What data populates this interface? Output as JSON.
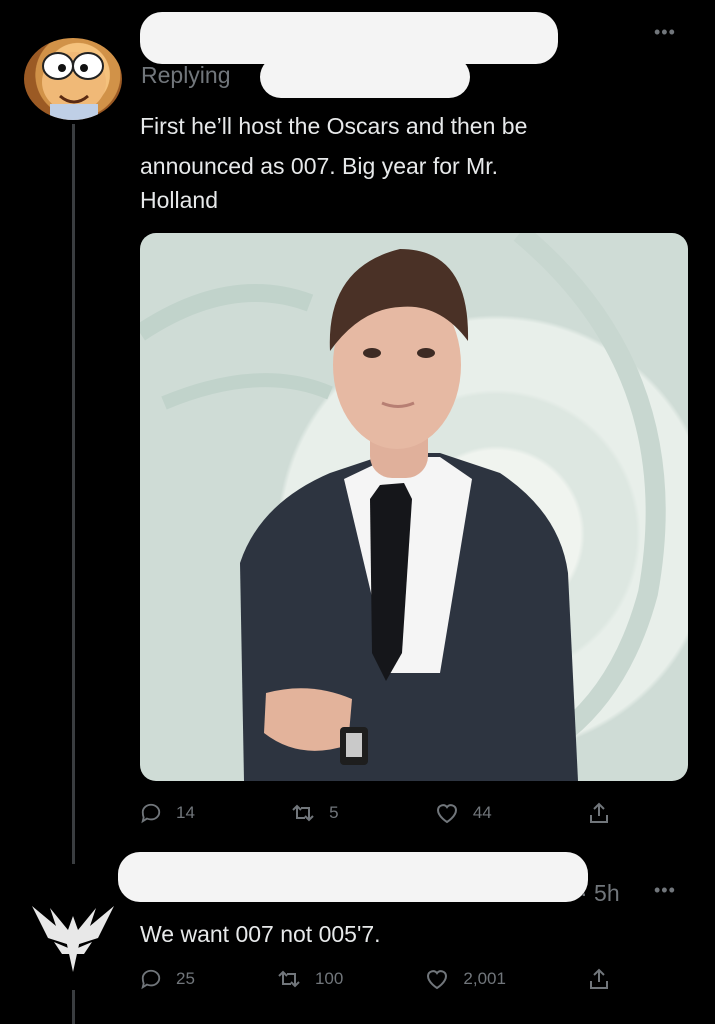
{
  "tweet1": {
    "replying_label": "Replying",
    "text_line1": "First he’ll host the Oscars and then be",
    "text_line2": "announced as 007. Big year for Mr.",
    "text_line3": "Holland",
    "stats": {
      "replies": "14",
      "retweets": "5",
      "likes": "44"
    }
  },
  "tweet2": {
    "time": "· 5h",
    "text": "We want 007 not 005'7.",
    "stats": {
      "replies": "25",
      "retweets": "100",
      "likes": "2,001"
    }
  },
  "icons": {
    "reply": "reply-icon",
    "retweet": "retweet-icon",
    "like": "heart-icon",
    "share": "share-icon",
    "more": "more-icon"
  },
  "colors": {
    "background": "#000000",
    "text": "#e7e9ea",
    "muted": "#71767b",
    "redaction": "#f4f4f4"
  }
}
